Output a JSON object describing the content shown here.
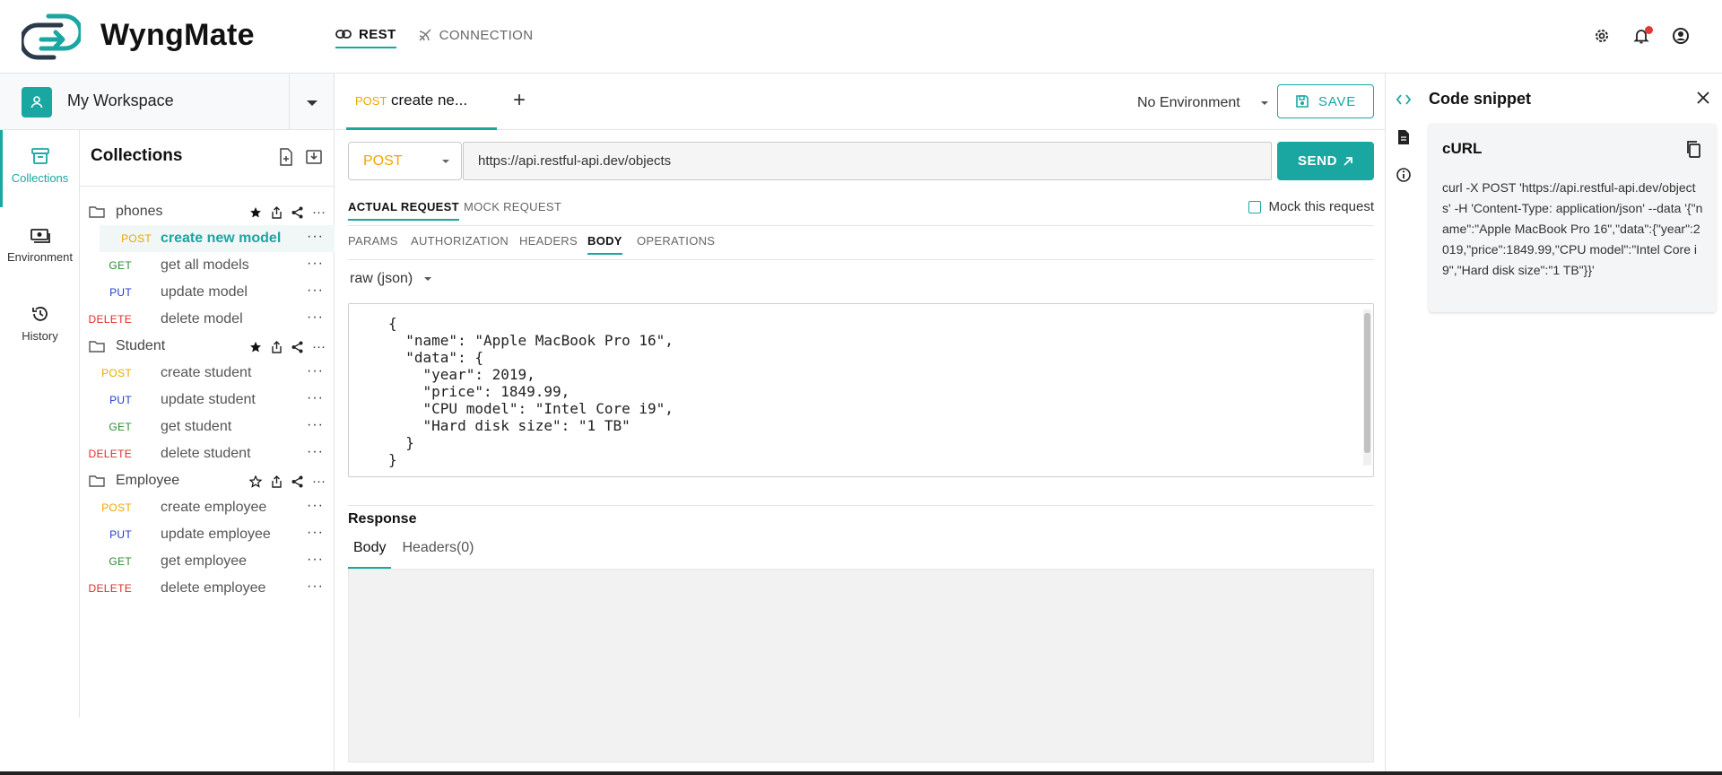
{
  "app": {
    "brand": "WyngMate",
    "colors": {
      "accent": "#1aa7a1",
      "post": "#f0a500",
      "get": "#2e8b32",
      "put": "#1f3bd6",
      "delete": "#e02b2b"
    }
  },
  "topnav": {
    "rest_label": "REST",
    "connection_label": "CONNECTION"
  },
  "workspace": {
    "name": "My Workspace"
  },
  "rail": {
    "collections_label": "Collections",
    "environment_label": "Environment",
    "history_label": "History"
  },
  "collections": {
    "title": "Collections",
    "folders": [
      {
        "name": "phones",
        "requests": [
          {
            "method": "POST",
            "name": "create new model"
          },
          {
            "method": "GET",
            "name": "get all models"
          },
          {
            "method": "PUT",
            "name": "update model"
          },
          {
            "method": "DELETE",
            "name": "delete model"
          }
        ]
      },
      {
        "name": "Student",
        "requests": [
          {
            "method": "POST",
            "name": "create student"
          },
          {
            "method": "PUT",
            "name": "update student"
          },
          {
            "method": "GET",
            "name": "get student"
          },
          {
            "method": "DELETE",
            "name": "delete student"
          }
        ]
      },
      {
        "name": "Employee",
        "requests": [
          {
            "method": "POST",
            "name": "create employee"
          },
          {
            "method": "PUT",
            "name": "update employee"
          },
          {
            "method": "GET",
            "name": "get employee"
          },
          {
            "method": "DELETE",
            "name": "delete employee"
          }
        ]
      }
    ],
    "more_label": "···"
  },
  "request_tab": {
    "method": "POST",
    "name": "create ne...",
    "add_label": "+"
  },
  "environment": {
    "selected": "No Environment"
  },
  "toolbar": {
    "save_label": "SAVE",
    "send_label": "SEND"
  },
  "request": {
    "method": "POST",
    "url": "https://api.restful-api.dev/objects"
  },
  "mode_tabs": {
    "actual": "ACTUAL REQUEST",
    "mock": "MOCK REQUEST",
    "mock_checkbox": "Mock this request"
  },
  "param_tabs": {
    "params": "PARAMS",
    "authorization": "AUTHORIZATION",
    "headers": "HEADERS",
    "body": "BODY",
    "operations": "OPERATIONS"
  },
  "body": {
    "type": "raw (json)",
    "content": "{\n  \"name\": \"Apple MacBook Pro 16\",\n  \"data\": {\n    \"year\": 2019,\n    \"price\": 1849.99,\n    \"CPU model\": \"Intel Core i9\",\n    \"Hard disk size\": \"1 TB\"\n  }\n}"
  },
  "response": {
    "title": "Response",
    "body_tab": "Body",
    "headers_tab": "Headers(0)"
  },
  "snippet": {
    "title": "Code snippet",
    "language": "cURL",
    "code": "curl -X POST 'https://api.restful-api.dev/objects' -H 'Content-Type: application/json' --data '{\"name\":\"Apple MacBook Pro 16\",\"data\":{\"year\":2019,\"price\":1849.99,\"CPU model\":\"Intel Core i9\",\"Hard disk size\":\"1 TB\"}}'"
  }
}
